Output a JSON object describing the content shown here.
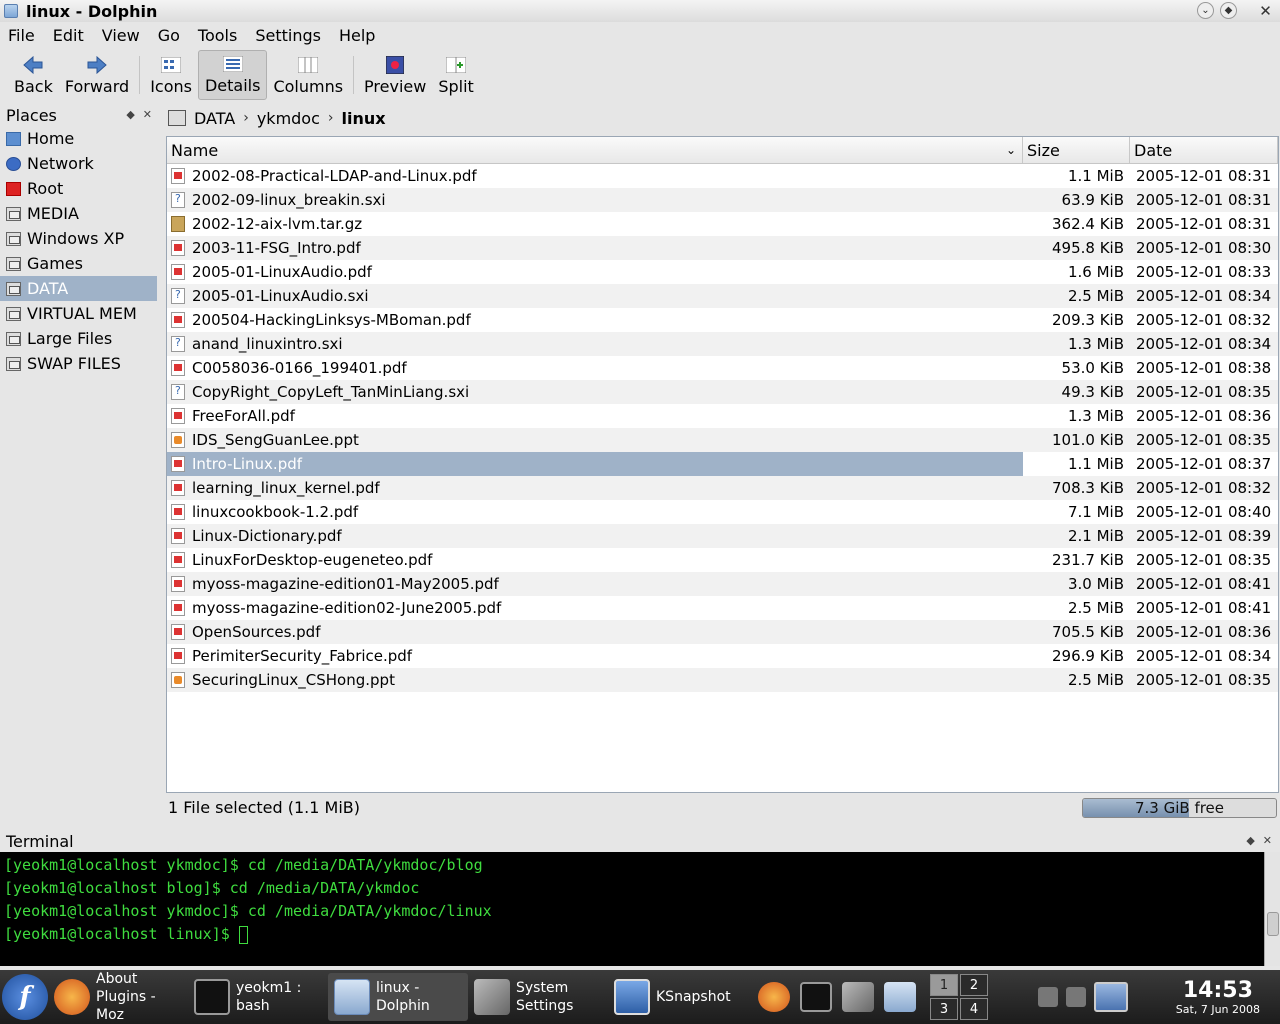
{
  "window": {
    "title": "linux - Dolphin"
  },
  "menu": [
    "File",
    "Edit",
    "View",
    "Go",
    "Tools",
    "Settings",
    "Help"
  ],
  "toolbar": {
    "back": "Back",
    "forward": "Forward",
    "icons": "Icons",
    "details": "Details",
    "columns": "Columns",
    "preview": "Preview",
    "split": "Split"
  },
  "places": {
    "title": "Places",
    "items": [
      {
        "label": "Home",
        "icon": "home-icon"
      },
      {
        "label": "Network",
        "icon": "network-icon"
      },
      {
        "label": "Root",
        "icon": "root-folder-icon"
      },
      {
        "label": "MEDIA",
        "icon": "drive-icon"
      },
      {
        "label": "Windows XP",
        "icon": "drive-icon"
      },
      {
        "label": "Games",
        "icon": "drive-icon"
      },
      {
        "label": "DATA",
        "icon": "drive-icon",
        "selected": true
      },
      {
        "label": "VIRTUAL MEM",
        "icon": "drive-icon"
      },
      {
        "label": "Large Files",
        "icon": "drive-icon"
      },
      {
        "label": "SWAP FILES",
        "icon": "drive-icon"
      }
    ]
  },
  "breadcrumb": [
    "DATA",
    "ykmdoc",
    "linux"
  ],
  "columns": {
    "name": "Name",
    "size": "Size",
    "date": "Date"
  },
  "files": [
    {
      "name": "2002-08-Practical-LDAP-and-Linux.pdf",
      "size": "1.1 MiB",
      "date": "2005-12-01 08:31",
      "type": "pdf"
    },
    {
      "name": "2002-09-linux_breakin.sxi",
      "size": "63.9 KiB",
      "date": "2005-12-01 08:31",
      "type": "sxi"
    },
    {
      "name": "2002-12-aix-lvm.tar.gz",
      "size": "362.4 KiB",
      "date": "2005-12-01 08:31",
      "type": "tgz"
    },
    {
      "name": "2003-11-FSG_Intro.pdf",
      "size": "495.8 KiB",
      "date": "2005-12-01 08:30",
      "type": "pdf"
    },
    {
      "name": "2005-01-LinuxAudio.pdf",
      "size": "1.6 MiB",
      "date": "2005-12-01 08:33",
      "type": "pdf"
    },
    {
      "name": "2005-01-LinuxAudio.sxi",
      "size": "2.5 MiB",
      "date": "2005-12-01 08:34",
      "type": "sxi"
    },
    {
      "name": "200504-HackingLinksys-MBoman.pdf",
      "size": "209.3 KiB",
      "date": "2005-12-01 08:32",
      "type": "pdf"
    },
    {
      "name": "anand_linuxintro.sxi",
      "size": "1.3 MiB",
      "date": "2005-12-01 08:34",
      "type": "sxi"
    },
    {
      "name": "C0058036-0166_199401.pdf",
      "size": "53.0 KiB",
      "date": "2005-12-01 08:38",
      "type": "pdf"
    },
    {
      "name": "CopyRight_CopyLeft_TanMinLiang.sxi",
      "size": "49.3 KiB",
      "date": "2005-12-01 08:35",
      "type": "sxi"
    },
    {
      "name": "FreeForAll.pdf",
      "size": "1.3 MiB",
      "date": "2005-12-01 08:36",
      "type": "pdf"
    },
    {
      "name": "IDS_SengGuanLee.ppt",
      "size": "101.0 KiB",
      "date": "2005-12-01 08:35",
      "type": "ppt"
    },
    {
      "name": "Intro-Linux.pdf",
      "size": "1.1 MiB",
      "date": "2005-12-01 08:37",
      "type": "pdf",
      "selected": true
    },
    {
      "name": "learning_linux_kernel.pdf",
      "size": "708.3 KiB",
      "date": "2005-12-01 08:32",
      "type": "pdf"
    },
    {
      "name": "linuxcookbook-1.2.pdf",
      "size": "7.1 MiB",
      "date": "2005-12-01 08:40",
      "type": "pdf"
    },
    {
      "name": "Linux-Dictionary.pdf",
      "size": "2.1 MiB",
      "date": "2005-12-01 08:39",
      "type": "pdf"
    },
    {
      "name": "LinuxForDesktop-eugeneteo.pdf",
      "size": "231.7 KiB",
      "date": "2005-12-01 08:35",
      "type": "pdf"
    },
    {
      "name": "myoss-magazine-edition01-May2005.pdf",
      "size": "3.0 MiB",
      "date": "2005-12-01 08:41",
      "type": "pdf"
    },
    {
      "name": "myoss-magazine-edition02-June2005.pdf",
      "size": "2.5 MiB",
      "date": "2005-12-01 08:41",
      "type": "pdf"
    },
    {
      "name": "OpenSources.pdf",
      "size": "705.5 KiB",
      "date": "2005-12-01 08:36",
      "type": "pdf"
    },
    {
      "name": "PerimiterSecurity_Fabrice.pdf",
      "size": "296.9 KiB",
      "date": "2005-12-01 08:34",
      "type": "pdf"
    },
    {
      "name": "SecuringLinux_CSHong.ppt",
      "size": "2.5 MiB",
      "date": "2005-12-01 08:35",
      "type": "ppt"
    }
  ],
  "status": {
    "selection": "1 File selected (1.1 MiB)",
    "free": "7.3 GiB free",
    "used_fraction": 0.55
  },
  "terminal": {
    "title": "Terminal",
    "lines": [
      "[yeokm1@localhost ykmdoc]$ cd /media/DATA/ykmdoc/blog",
      "[yeokm1@localhost blog]$ cd /media/DATA/ykmdoc",
      "[yeokm1@localhost ykmdoc]$ cd /media/DATA/ykmdoc/linux",
      "[yeokm1@localhost linux]$ "
    ]
  },
  "taskbar": {
    "tasks": [
      {
        "label": "About Plugins - Moz",
        "icon": "firefox-icon"
      },
      {
        "label": "yeokm1 : bash",
        "icon": "terminal-icon"
      },
      {
        "label": "linux - Dolphin",
        "icon": "dolphin-icon",
        "active": true
      },
      {
        "label": "System Settings",
        "icon": "system-settings-icon"
      },
      {
        "label": "KSnapshot",
        "icon": "ksnapshot-icon"
      }
    ],
    "pager": [
      "1",
      "2",
      "3",
      "4"
    ],
    "time": "14:53",
    "date": "Sat, 7 Jun 2008"
  }
}
